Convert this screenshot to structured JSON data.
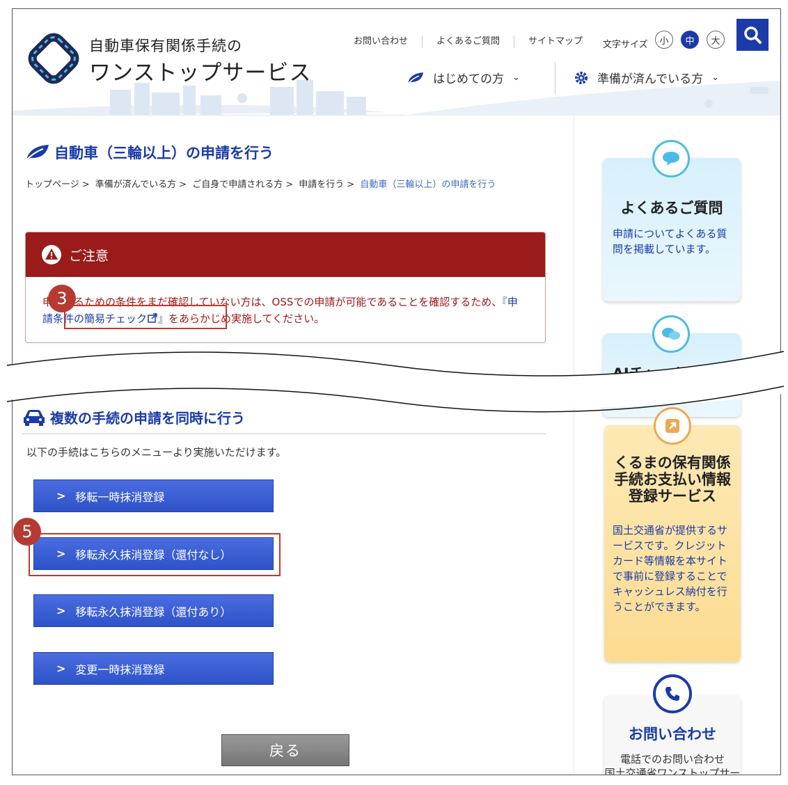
{
  "header": {
    "site_title_1": "自動車保有関係手続の",
    "site_title_2": "ワンストップサービス",
    "top_links": [
      "お問い合わせ",
      "よくあるご質問",
      "サイトマップ"
    ],
    "font_size_label": "文字サイズ",
    "font_sizes": [
      "小",
      "中",
      "大"
    ],
    "font_size_selected": "中",
    "nav": [
      {
        "label": "はじめての方",
        "icon": "leaf-icon"
      },
      {
        "label": "準備が済んでいる方",
        "icon": "gear-icon"
      }
    ]
  },
  "page": {
    "title": "自動車（三輪以上）の申請を行う",
    "breadcrumb": [
      "トップページ",
      "準備が済んでいる方",
      "ご自身で申請される方",
      "申請を行う",
      "自動車（三輪以上）の申請を行う"
    ]
  },
  "notice": {
    "heading": "ご注意",
    "text_before": "申請するための条件をまだ確認していない方は、OSSでの申請が可能であることを確認するため、",
    "link": "『申請条件の簡易チェック",
    "link_close": "』",
    "text_after": "をあらかじめ実施してください。"
  },
  "section": {
    "title": "複数の手続の申請を同時に行う",
    "description": "以下の手続はこちらのメニューより実施いただけます。",
    "buttons": [
      "移転一時抹消登録",
      "移転永久抹消登録（還付なし）",
      "移転永久抹消登録（還付あり）",
      "変更一時抹消登録"
    ],
    "back": "戻る"
  },
  "steps": [
    "3",
    "5"
  ],
  "sidebar": {
    "faq": {
      "title": "よくあるご質問",
      "text": "申請についてよくある質問を掲載しています。"
    },
    "chat": {
      "title": "AIチャットで質問"
    },
    "payment": {
      "title_lines": [
        "くるまの保有関係",
        "手続お支払い情報",
        "登録サービス"
      ],
      "text": "国土交通省が提供するサービスです。クレジットカード等情報を本サイトで事前に登録することでキャッシュレス納付を行うことができます。"
    },
    "contact": {
      "title": "お問い合わせ",
      "text_lines": [
        "電話でのお問い合わせ",
        "国土交通省ワンストップサービス"
      ]
    }
  },
  "colors": {
    "brand": "#1a3ba8",
    "notice": "#9b1b1b",
    "highlight": "#c0392b"
  }
}
